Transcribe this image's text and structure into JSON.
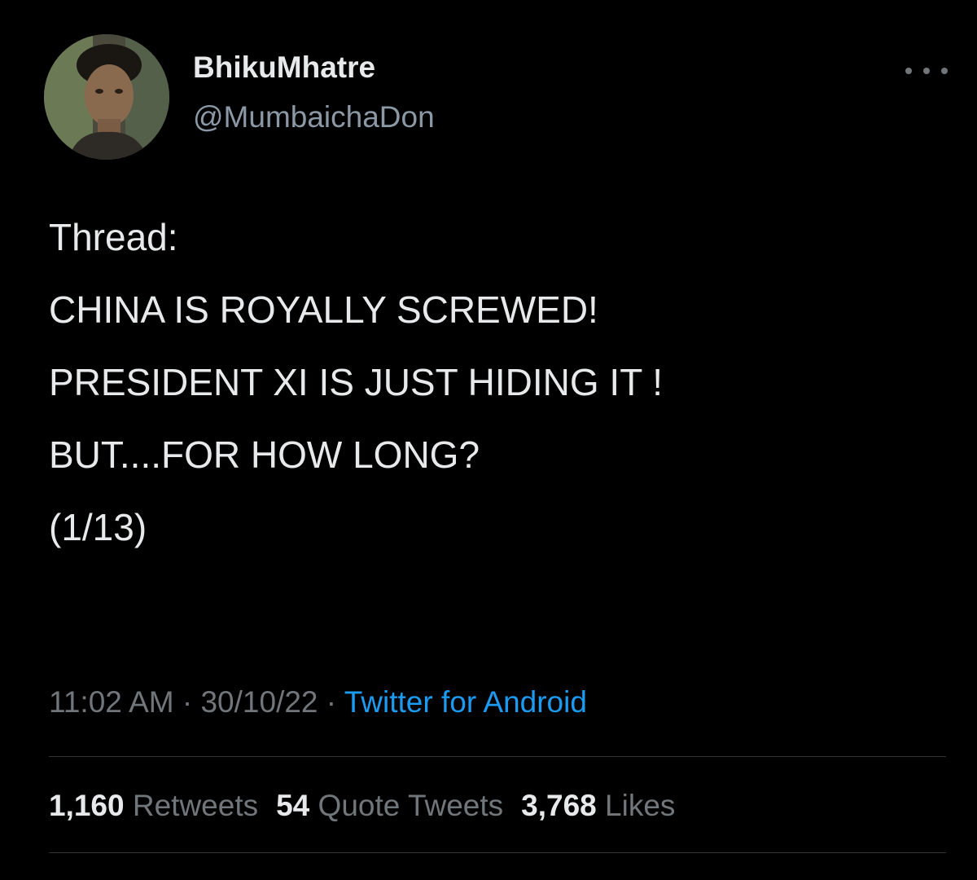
{
  "user": {
    "display_name": "BhikuMhatre",
    "handle": "@MumbaichaDon"
  },
  "tweet": {
    "lines": [
      "Thread:",
      "CHINA IS ROYALLY SCREWED!",
      "PRESIDENT XI IS JUST HIDING IT !",
      "BUT....FOR HOW LONG?",
      "(1/13)"
    ],
    "time": "11:02 AM",
    "date": "30/10/22",
    "source": "Twitter for Android",
    "separator": " · "
  },
  "stats": {
    "retweets_count": "1,160",
    "retweets_label": "Retweets",
    "quotes_count": "54",
    "quotes_label": "Quote Tweets",
    "likes_count": "3,768",
    "likes_label": "Likes"
  },
  "icons": {
    "more": "more-options-icon",
    "avatar": "profile-photo"
  },
  "colors": {
    "background": "#000000",
    "text": "#e7e9ea",
    "secondary": "#71767b",
    "link": "#1d9bf0",
    "divider": "#2f3336"
  }
}
